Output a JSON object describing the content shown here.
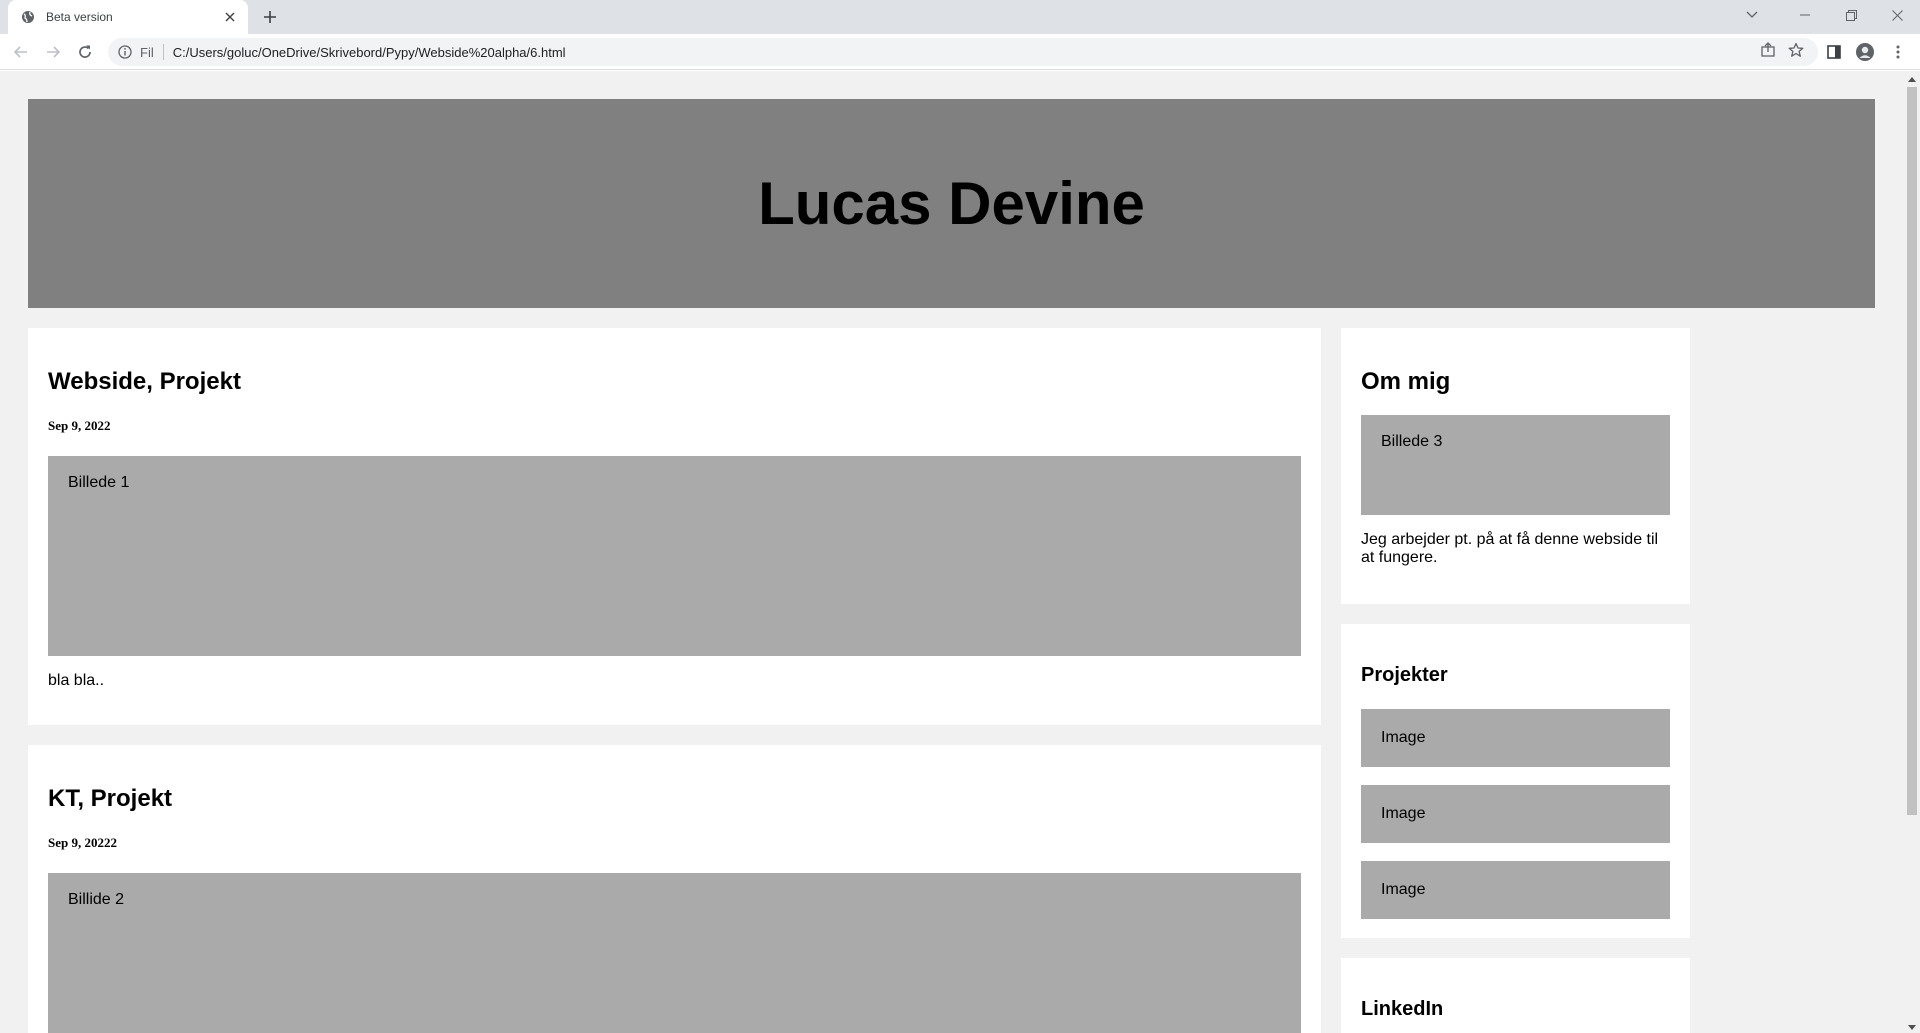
{
  "browser": {
    "tab_title": "Beta version",
    "site_info_label": "Fil",
    "url": "C:/Users/goluc/OneDrive/Skrivebord/Pypy/Webside%20alpha/6.html"
  },
  "page": {
    "header_title": "Lucas Devine",
    "posts": [
      {
        "title": "Webside, Projekt",
        "date": "Sep 9, 2022",
        "image_label": "Billede 1",
        "text": "bla bla.."
      },
      {
        "title": "KT, Projekt",
        "date": "Sep 9, 20222",
        "image_label": "Billide 2"
      }
    ],
    "sidebar": {
      "about": {
        "title": "Om mig",
        "image_label": "Billede 3",
        "text": "Jeg arbejder pt. på at få denne webside til at fungere."
      },
      "projects": {
        "title": "Projekter",
        "items": [
          "Image",
          "Image",
          "Image"
        ]
      },
      "linkedin": {
        "title": "LinkedIn"
      }
    }
  },
  "colors": {
    "header_bg": "#808080",
    "image_bg": "#aaaaaa",
    "page_bg": "#f1f1f1"
  }
}
